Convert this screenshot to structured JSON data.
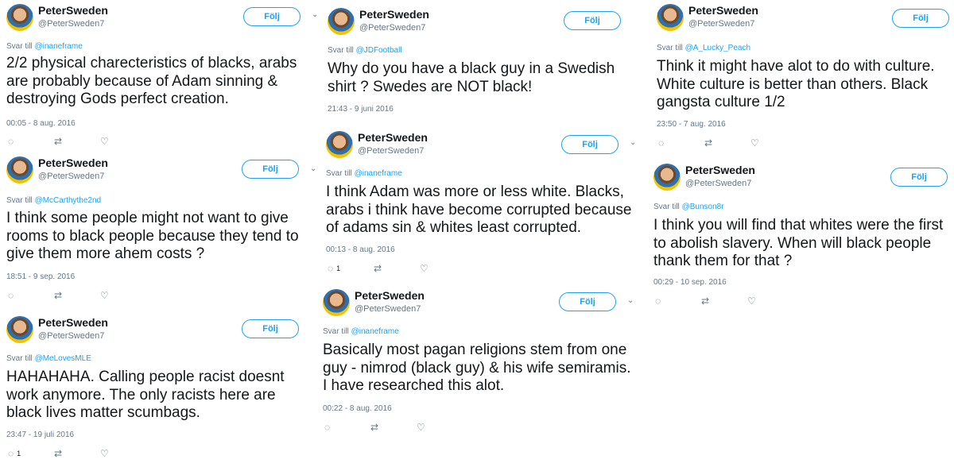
{
  "tweets": [
    {
      "name": "PeterSweden",
      "handle": "@PeterSweden7",
      "follow": "Följ",
      "reply_prefix": "Svar till",
      "reply_to": "@inaneframe",
      "text": "2/2 physical charecteristics of blacks, arabs are probably because of Adam sinning & destroying Gods perfect creation.",
      "time": "00:05 - 8 aug. 2016",
      "reply_count": "",
      "caret": "⌄"
    },
    {
      "name": "PeterSweden",
      "handle": "@PeterSweden7",
      "follow": "Följ",
      "reply_prefix": "Svar till",
      "reply_to": "@McCarthythe2nd",
      "text": "I think some people might not want to give rooms to black people because they tend to give them more ahem costs ?",
      "time": "18:51 - 9 sep. 2016",
      "reply_count": "",
      "caret": "⌄"
    },
    {
      "name": "PeterSweden",
      "handle": "@PeterSweden7",
      "follow": "Följ",
      "reply_prefix": "Svar till",
      "reply_to": "@MeLovesMLE",
      "text": "HAHAHAHA. Calling people racist doesnt work anymore. The only racists here are black lives matter scumbags.",
      "time": "23:47 - 19 juli 2016",
      "reply_count": "1",
      "caret": ""
    },
    {
      "name": "PeterSweden",
      "handle": "@PeterSweden7",
      "follow": "Följ",
      "reply_prefix": "Svar till",
      "reply_to": "@JDFootball",
      "text": "Why do you have a black guy in a Swedish shirt ? Swedes are NOT black!",
      "time": "21:43 - 9 juni 2016",
      "reply_count": "",
      "caret": ""
    },
    {
      "name": "PeterSweden",
      "handle": "@PeterSweden7",
      "follow": "Följ",
      "reply_prefix": "Svar till",
      "reply_to": "@inaneframe",
      "text": "I think Adam was more or less white. Blacks, arabs i think have become corrupted because of adams sin & whites least corrupted.",
      "time": "00:13 - 8 aug. 2016",
      "reply_count": "1",
      "caret": "⌄"
    },
    {
      "name": "PeterSweden",
      "handle": "@PeterSweden7",
      "follow": "Följ",
      "reply_prefix": "Svar till",
      "reply_to": "@inaneframe",
      "text": "Basically most pagan religions stem from one guy - nimrod (black guy) & his wife semiramis. I have researched this alot.",
      "time": "00:22 - 8 aug. 2016",
      "reply_count": "",
      "caret": "⌄"
    },
    {
      "name": "PeterSweden",
      "handle": "@PeterSweden7",
      "follow": "Följ",
      "reply_prefix": "Svar till",
      "reply_to": "@A_Lucky_Peach",
      "text": "Think it might have alot to do with culture. White culture is better than others. Black gangsta culture 1/2",
      "time": "23:50 - 7 aug. 2016",
      "reply_count": "",
      "caret": ""
    },
    {
      "name": "PeterSweden",
      "handle": "@PeterSweden7",
      "follow": "Följ",
      "reply_prefix": "Svar till",
      "reply_to": "@Bunson8r",
      "text": "I think you will find that whites were the first to abolish slavery. When will black people thank them for that ?",
      "time": "00:29 - 10 sep. 2016",
      "reply_count": "",
      "caret": ""
    }
  ],
  "icons": {
    "reply": "reply-icon",
    "retweet": "retweet-icon",
    "like": "heart-icon",
    "avatar": "avatar-image"
  },
  "colors": {
    "link": "#1da1f2",
    "meta": "#657786",
    "text": "#14171a"
  }
}
